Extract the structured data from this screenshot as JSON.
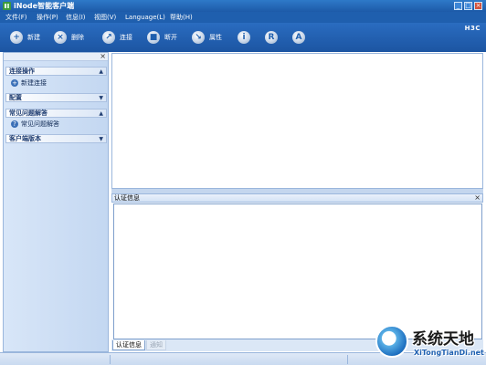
{
  "window": {
    "title": "iNode智能客户端",
    "minimize_glyph": "_",
    "maximize_glyph": "□",
    "close_glyph": "×"
  },
  "menu": [
    {
      "label": "文件(F)"
    },
    {
      "label": "操作(P)"
    },
    {
      "label": "信息(I)"
    },
    {
      "label": "视图(V)"
    },
    {
      "label": "Language(L)"
    },
    {
      "label": "帮助(H)"
    }
  ],
  "toolbar": {
    "new": {
      "label": "新建",
      "glyph": "+",
      "icon": "plus-icon"
    },
    "delete": {
      "label": "删除",
      "glyph": "×",
      "icon": "close-circle-icon"
    },
    "connect": {
      "label": "连接",
      "glyph": "↗",
      "icon": "connect-icon"
    },
    "disconnect": {
      "label": "断开",
      "glyph": "■",
      "icon": "disconnect-icon"
    },
    "properties": {
      "label": "属性",
      "glyph": "↘",
      "icon": "properties-icon"
    },
    "info_glyph": "i",
    "r_glyph": "R",
    "a_glyph": "A",
    "brand": "H3C"
  },
  "sidebar": {
    "close_glyph": "×",
    "sections": [
      {
        "title": "连接操作",
        "arrow": "▲",
        "items": [
          {
            "label": "新建连接",
            "glyph": "+"
          }
        ]
      },
      {
        "title": "配置",
        "arrow": "▼",
        "items": []
      },
      {
        "title": "常见问题解答",
        "arrow": "▲",
        "items": [
          {
            "label": "常见问题解答",
            "glyph": "?"
          }
        ]
      },
      {
        "title": "客户端版本",
        "arrow": "▼",
        "items": []
      }
    ]
  },
  "auth_panel": {
    "title": "认证信息",
    "close_glyph": "×",
    "tabs": [
      {
        "label": "认证信息",
        "active": true
      },
      {
        "label": "通知",
        "active": false
      }
    ]
  },
  "watermark": {
    "title": "系统天地",
    "url": "XiTongTianDi.net"
  }
}
